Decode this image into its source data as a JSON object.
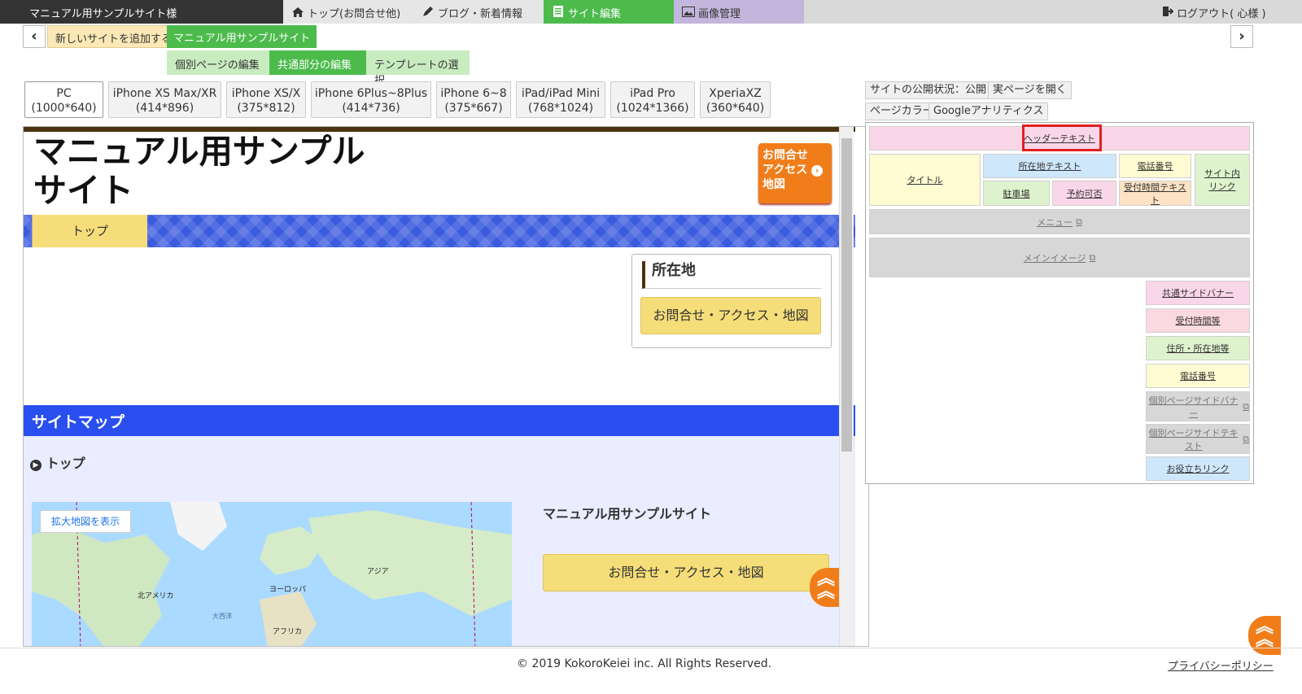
{
  "topbar": {
    "site_name": "マニュアル用サンプルサイト様",
    "tabs": [
      {
        "label": "トップ(お問合せ他)",
        "icon": "home-icon"
      },
      {
        "label": "ブログ・新着情報",
        "icon": "pen-icon"
      },
      {
        "label": "サイト編集",
        "icon": "document-icon"
      },
      {
        "label": "画像管理",
        "icon": "image-icon"
      }
    ],
    "logout_label": "ログアウト( 心様 )"
  },
  "site_row": {
    "add_site": "新しいサイトを追加する",
    "current_site": "マニュアル用サンプルサイト"
  },
  "subtabs": {
    "individual": "個別ページの編集",
    "common": "共通部分の編集",
    "template": "テンプレートの選択"
  },
  "devices": [
    {
      "name": "PC",
      "size": "(1000*640)"
    },
    {
      "name": "iPhone XS Max/XR",
      "size": "(414*896)"
    },
    {
      "name": "iPhone XS/X",
      "size": "(375*812)"
    },
    {
      "name": "iPhone 6Plus~8Plus",
      "size": "(414*736)"
    },
    {
      "name": "iPhone 6~8",
      "size": "(375*667)"
    },
    {
      "name": "iPad/iPad Mini",
      "size": "(768*1024)"
    },
    {
      "name": "iPad Pro",
      "size": "(1024*1366)"
    },
    {
      "name": "XperiaXZ",
      "size": "(360*640)"
    }
  ],
  "preview": {
    "site_title_line1": "マニュアル用サンプル",
    "site_title_line2": "サイト",
    "contact_btn": [
      "お問合せ",
      "アクセス",
      "地図"
    ],
    "nav_top": "トップ",
    "location_title": "所在地",
    "location_btn": "お問合せ・アクセス・地図",
    "sitemap_title": "サイトマップ",
    "sitemap_top": "トップ",
    "map_button": "拡大地図を表示",
    "map_labels": [
      "北アメリカ",
      "ヨーロッパ",
      "アジア",
      "大西洋",
      "アフリカ"
    ],
    "site_name": "マニュアル用サンプルサイト",
    "contact2_btn": "お問合せ・アクセス・地図"
  },
  "right_panel": {
    "publish_status": "サイトの公開状況：公開",
    "open_page": "実ページを開く",
    "page_color": "ページカラー",
    "google_analytics": "Googleアナリティクス",
    "blocks": {
      "header_text": "ヘッダーテキスト",
      "title": "タイトル",
      "location_text": "所在地テキスト",
      "phone_number": "電話番号",
      "site_link": "サイト内リンク",
      "parking": "駐車場",
      "reservation": "予約可否",
      "hours_text": "受付時間テキスト",
      "menu": "メニュー",
      "main_image": "メインイメージ",
      "common_banner": "共通サイドバナー",
      "hours": "受付時間等",
      "address": "住所・所在地等",
      "phone2": "電話番号",
      "individual_banner": "個別ページサイドバナー",
      "individual_text": "個別ページサイドテキスト",
      "useful_links": "お役立ちリンク"
    }
  },
  "footer": {
    "copyright": "© 2019 KokoroKeiei inc. All Rights Reserved.",
    "privacy": "プライバシーポリシー"
  }
}
